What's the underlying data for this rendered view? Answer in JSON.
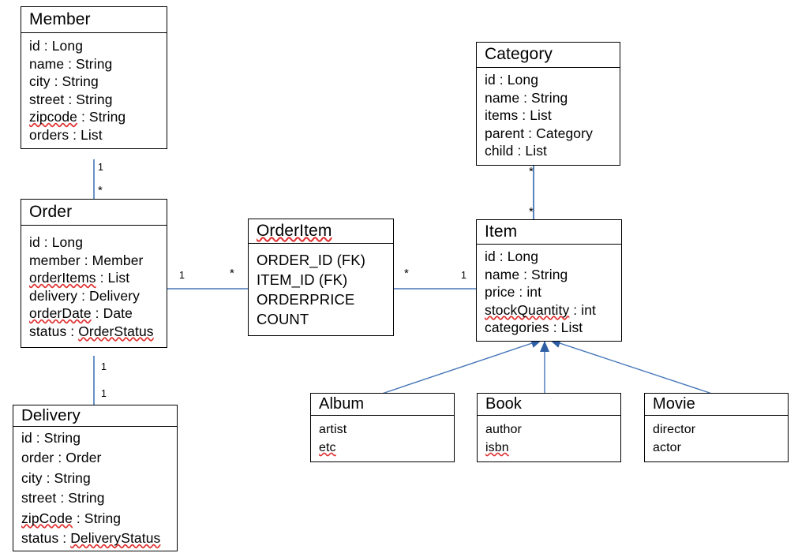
{
  "diagram": {
    "kind": "uml-class-diagram",
    "edge_color": "#4676B8",
    "arrow_color": "#2E5FA4",
    "box_border_color": "#000000",
    "background_color": "#FFFFFF",
    "spellcheck_underline_color": "#E03131"
  },
  "classes": {
    "member": {
      "name": "Member",
      "attributes": [
        {
          "text": "id : Long",
          "misspelled": false
        },
        {
          "text": "name : String",
          "misspelled": false
        },
        {
          "text": "city : String",
          "misspelled": false
        },
        {
          "text": "street : String",
          "misspelled": false
        },
        {
          "text": "zipcode : String",
          "misspelled": true,
          "misspelled_token": "zipcode"
        },
        {
          "text": "orders : List",
          "misspelled": false
        }
      ]
    },
    "order": {
      "name": "Order",
      "attributes": [
        {
          "text": "id : Long",
          "misspelled": false
        },
        {
          "text": "member : Member",
          "misspelled": false
        },
        {
          "text": "orderItems : List",
          "misspelled": true,
          "misspelled_token": "orderItems"
        },
        {
          "text": "delivery : Delivery",
          "misspelled": false
        },
        {
          "text": "orderDate : Date",
          "misspelled": true,
          "misspelled_token": "orderDate"
        },
        {
          "text": "status : OrderStatus",
          "misspelled": true,
          "misspelled_token": "OrderStatus"
        }
      ]
    },
    "delivery": {
      "name": "Delivery",
      "attributes": [
        {
          "text": "id : String",
          "misspelled": false
        },
        {
          "text": "order : Order",
          "misspelled": false
        },
        {
          "text": "city : String",
          "misspelled": false
        },
        {
          "text": "street : String",
          "misspelled": false
        },
        {
          "text": "zipCode : String",
          "misspelled": true,
          "misspelled_token": "zipCode"
        },
        {
          "text": "status : DeliveryStatus",
          "misspelled": true,
          "misspelled_token": "DeliveryStatus"
        }
      ]
    },
    "orderitem": {
      "name": "OrderItem",
      "name_misspelled": true,
      "attributes": [
        {
          "text": "ORDER_ID (FK)",
          "misspelled": false
        },
        {
          "text": "ITEM_ID (FK)",
          "misspelled": false
        },
        {
          "text": "ORDERPRICE",
          "misspelled": false
        },
        {
          "text": "COUNT",
          "misspelled": false
        }
      ]
    },
    "item": {
      "name": "Item",
      "attributes": [
        {
          "text": "id : Long",
          "misspelled": false
        },
        {
          "text": "name : String",
          "misspelled": false
        },
        {
          "text": "price : int",
          "misspelled": false
        },
        {
          "text": "stockQuantity : int",
          "misspelled": true,
          "misspelled_token": "stockQuantity"
        },
        {
          "text": "categories : List",
          "misspelled": false
        }
      ]
    },
    "category": {
      "name": "Category",
      "attributes": [
        {
          "text": "id : Long",
          "misspelled": false
        },
        {
          "text": "name : String",
          "misspelled": false
        },
        {
          "text": "items : List",
          "misspelled": false
        },
        {
          "text": "parent : Category",
          "misspelled": false
        },
        {
          "text": "child : List",
          "misspelled": false
        }
      ]
    },
    "album": {
      "name": "Album",
      "attributes": [
        {
          "text": "artist",
          "misspelled": false
        },
        {
          "text": "etc",
          "misspelled": true,
          "misspelled_token": "etc"
        }
      ]
    },
    "book": {
      "name": "Book",
      "attributes": [
        {
          "text": "author",
          "misspelled": false
        },
        {
          "text": "isbn",
          "misspelled": true,
          "misspelled_token": "isbn"
        }
      ]
    },
    "movie": {
      "name": "Movie",
      "attributes": [
        {
          "text": "director",
          "misspelled": false
        },
        {
          "text": "actor",
          "misspelled": false
        }
      ]
    }
  },
  "multiplicities": {
    "member_to_order_near_member": "1",
    "member_to_order_near_order": "*",
    "order_to_delivery_near_order": "1",
    "order_to_delivery_near_delivery": "1",
    "order_to_orderitem_near_order": "1",
    "order_to_orderitem_near_orderitem": "*",
    "orderitem_to_item_near_orderitem": "*",
    "orderitem_to_item_near_item": "1",
    "category_to_item_near_category": "*",
    "category_to_item_near_item": "*"
  },
  "relationships": [
    {
      "from": "Member",
      "to": "Order",
      "type": "association",
      "from_mult": "1",
      "to_mult": "*"
    },
    {
      "from": "Order",
      "to": "Delivery",
      "type": "association",
      "from_mult": "1",
      "to_mult": "1"
    },
    {
      "from": "Order",
      "to": "OrderItem",
      "type": "association",
      "from_mult": "1",
      "to_mult": "*"
    },
    {
      "from": "OrderItem",
      "to": "Item",
      "type": "association",
      "from_mult": "*",
      "to_mult": "1"
    },
    {
      "from": "Category",
      "to": "Item",
      "type": "association",
      "from_mult": "*",
      "to_mult": "*"
    },
    {
      "from": "Album",
      "to": "Item",
      "type": "generalization"
    },
    {
      "from": "Book",
      "to": "Item",
      "type": "generalization"
    },
    {
      "from": "Movie",
      "to": "Item",
      "type": "generalization"
    }
  ]
}
